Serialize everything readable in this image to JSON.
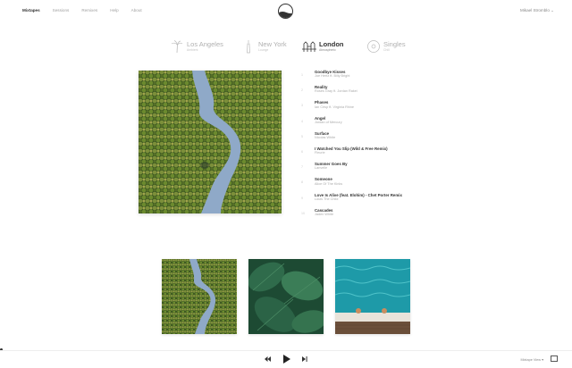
{
  "nav": {
    "items": [
      "Mixtapes",
      "Sessions",
      "Remixes",
      "Help",
      "About"
    ],
    "active_index": 0,
    "account": "Mikael Stromblo ⌄"
  },
  "city_tabs": [
    {
      "name": "Los Angeles",
      "sub": "Ambient",
      "icon": "palm-tree-icon",
      "active": false
    },
    {
      "name": "New York",
      "sub": "Lounge",
      "icon": "skyscraper-icon",
      "active": false
    },
    {
      "name": "London",
      "sub": "Atmospheric",
      "icon": "tower-bridge-icon",
      "active": true
    },
    {
      "name": "Singles",
      "sub": "Chill",
      "icon": "vinyl-record-icon",
      "active": false
    }
  ],
  "tracks": [
    {
      "num": "1",
      "title": "Goodbye Kisses",
      "artist": "Joe Hertz ft. Billy Bright"
    },
    {
      "num": "2",
      "title": "Reality",
      "artist": "Roses Gray ft. Jordan Rakei"
    },
    {
      "num": "3",
      "title": "Phases",
      "artist": "Ian Crisp ft. Virginia Rhine"
    },
    {
      "num": "4",
      "title": "Angel",
      "artist": "Jordan of Mercury"
    },
    {
      "num": "5",
      "title": "Surface",
      "artist": "Nicolas White"
    },
    {
      "num": "6",
      "title": "I Watched You Slip (Wild & Free Remix)",
      "artist": "Fleurie"
    },
    {
      "num": "7",
      "title": "Summer Goes By",
      "artist": "Lanvelle"
    },
    {
      "num": "8",
      "title": "Someone",
      "artist": "Alice Of The Kinks"
    },
    {
      "num": "9",
      "title": "Love Is Alive (feat. Elohim) - Chet Porter Remix",
      "artist": "Louis The Child"
    },
    {
      "num": "10",
      "title": "Cascades",
      "artist": "Jaden White"
    }
  ],
  "thumbnails": [
    "river-forest",
    "green-leaves",
    "pool-edge"
  ],
  "player": {
    "prev_icon": "previous-track-icon",
    "play_icon": "play-icon",
    "next_icon": "next-track-icon",
    "right_label": "Mixtape View ▾"
  },
  "colors": {
    "text": "#333333",
    "muted": "#a0a0a0",
    "accent": "#333333"
  }
}
